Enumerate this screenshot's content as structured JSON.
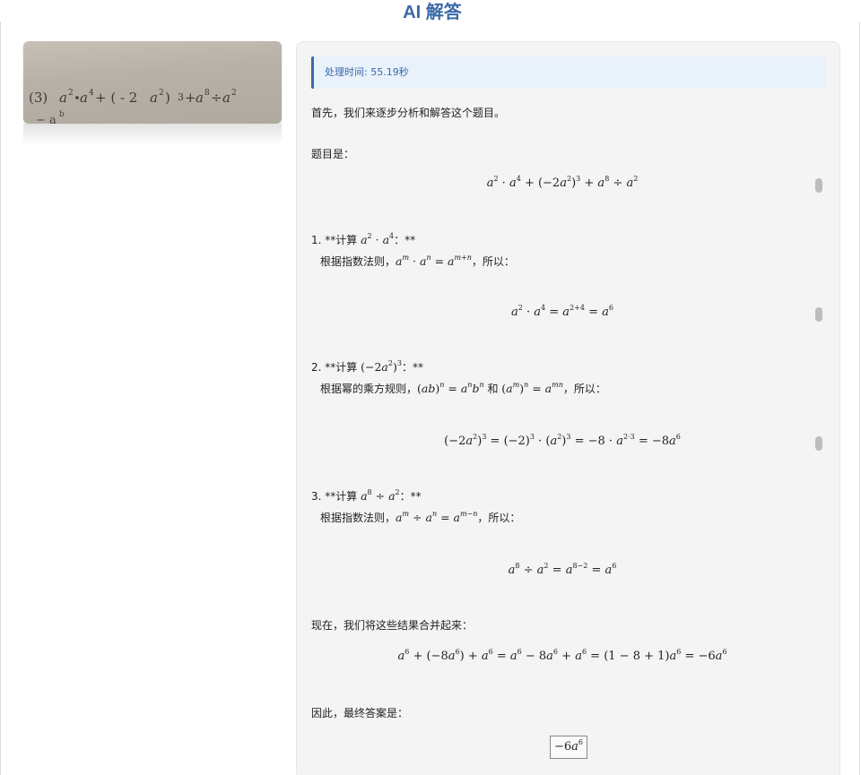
{
  "header": {
    "title": "AI 解答"
  },
  "photo": {
    "problem_text": "(3) a²•a⁴+ ( - 2a²) ³+a⁸÷a²"
  },
  "answer": {
    "processing_time": "处理时间: 55.19秒",
    "intro": "首先，我们来逐步分析和解答这个题目。",
    "problem_label": "题目是：",
    "step1_prefix": "1. **计算 ",
    "step1_suffix": "：**",
    "step1_rule_prefix": "根据指数法则，",
    "step1_rule_suffix": "，所以：",
    "step2_prefix": "2. **计算 ",
    "step2_suffix": "：**",
    "step2_rule_prefix": "根据幂的乘方规则，",
    "step2_rule_and": " 和 ",
    "step2_rule_suffix": "，所以：",
    "step3_prefix": "3. **计算 ",
    "step3_suffix": "：**",
    "step3_rule_prefix": "根据指数法则，",
    "step3_rule_suffix": "，所以：",
    "combine_label": "现在，我们将这些结果合并起来：",
    "final_label": "因此，最终答案是：",
    "final_answer": "−6a⁶"
  }
}
